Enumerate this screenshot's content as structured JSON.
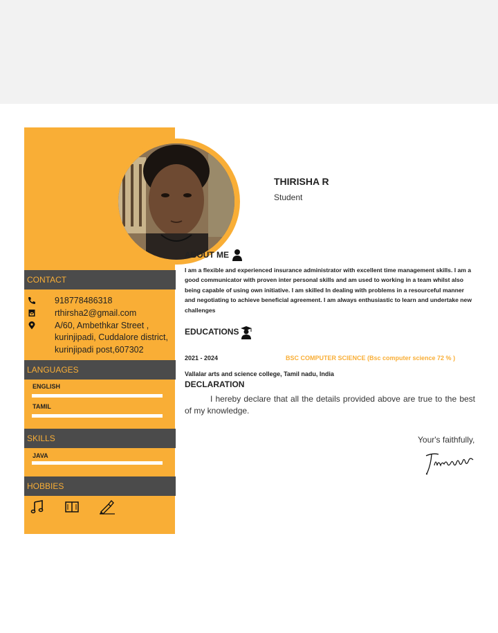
{
  "profile": {
    "name": "THIRISHA R",
    "role": "Student"
  },
  "contact": {
    "title": "CONTACT",
    "phone": "918778486318",
    "email": "rthirsha2@gmail.com",
    "address_lines": [
      "A/60, Ambethkar Street ,",
      "kurinjipadi, Cuddalore district,",
      "kurinjipadi post,607302"
    ]
  },
  "languages": {
    "title": "LANGUAGES",
    "items": [
      {
        "label": "ENGLISH",
        "level": 1.0
      },
      {
        "label": "TAMIL",
        "level": 1.0
      }
    ]
  },
  "skills": {
    "title": "SKILLS",
    "items": [
      {
        "label": "JAVA",
        "level": 1.0
      }
    ]
  },
  "hobbies": {
    "title": "HOBBIES",
    "icons": [
      "music-note-icon",
      "book-icon",
      "writing-hand-icon"
    ]
  },
  "about": {
    "title": "ABOUT ME",
    "text": "I am a flexible and experienced insurance administrator with excellent time management skills. I am a good communicator with proven inter personal skills and am used to working in a team whilst also being capable of using own initiative. I am skilled In dealing with problems in a resourceful manner and negotiating to achieve beneficial agreement. I am always enthusiastic to learn and undertake new challenges"
  },
  "education": {
    "title": "EDUCATIONS",
    "years": "2021 - 2024",
    "degree": "BSC COMPUTER SCIENCE (Bsc computer science 72 % )",
    "college": "Vallalar arts and science college, Tamil nadu, India"
  },
  "declaration": {
    "title": "DECLARATION",
    "text": "I hereby declare that all the details provided above are true to the best of my knowledge.",
    "closing": "Your's faithfully,",
    "signature": "Thirisha"
  },
  "colors": {
    "accent": "#f9ae36",
    "bar": "#4b4b4b",
    "top_band": "#f2f2f2"
  }
}
